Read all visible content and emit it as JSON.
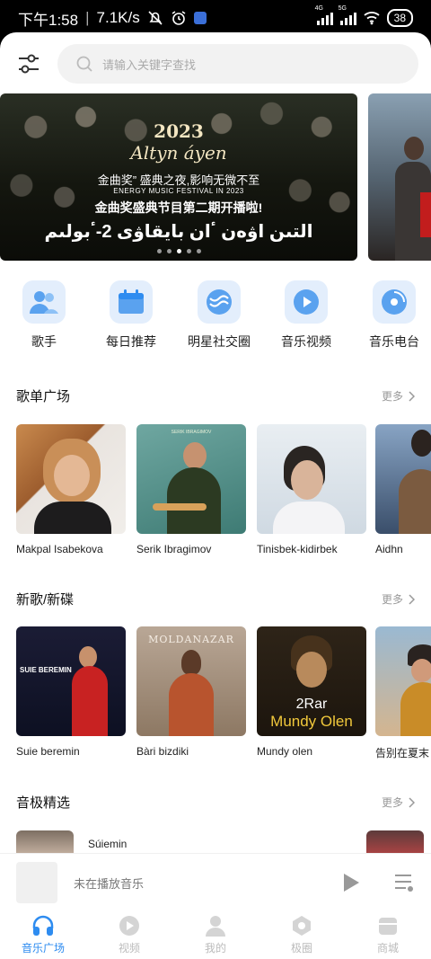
{
  "status_bar": {
    "time": "下午1:58",
    "speed": "7.1K/s",
    "network1": "4G",
    "network2": "5G",
    "battery": "38"
  },
  "search": {
    "placeholder": "请输入关键字查找"
  },
  "banner": {
    "year": "2023",
    "name": "Altyn áyen",
    "line1": "金曲奖” 盛典之夜,影响无微不至",
    "line2": "ENERGY MUSIC FESTIVAL IN 2023",
    "line3": "金曲奖盛典节目第二期开播啦!",
    "line4": "التىن اۋەن ٴان بايقاۋى 2-ٴبولىم"
  },
  "categories": [
    {
      "label": "歌手",
      "icon": "singer-icon"
    },
    {
      "label": "每日推荐",
      "icon": "calendar-icon"
    },
    {
      "label": "明星社交圈",
      "icon": "social-icon"
    },
    {
      "label": "音乐视频",
      "icon": "video-icon"
    },
    {
      "label": "音乐电台",
      "icon": "radio-icon"
    }
  ],
  "section_playlists": {
    "title": "歌单广场",
    "more": "更多",
    "items": [
      {
        "title": "Makpal Isabekova"
      },
      {
        "title": "Serik Ibragimov",
        "cover_text": "SERIK IBRAGIMOV"
      },
      {
        "title": "Tinisbek-kidirbek"
      },
      {
        "title": "Aidhn"
      }
    ]
  },
  "section_albums": {
    "title": "新歌/新碟",
    "more": "更多",
    "items": [
      {
        "title": "Suie beremin",
        "cover_text": "SUIE BEREMIN"
      },
      {
        "title": "Bàri bizdiki",
        "cover_text": "MOLDANAZAR"
      },
      {
        "title": "Mundy olen",
        "cover_text_1": "2Rar",
        "cover_text_2": "Mundy Olen"
      },
      {
        "title": "告别在夏末"
      }
    ]
  },
  "section_selected": {
    "title": "音极精选",
    "more": "更多",
    "first_item": "Súiemin"
  },
  "player": {
    "status": "未在播放音乐"
  },
  "tabs": [
    {
      "label": "音乐广场",
      "active": true,
      "icon": "headphones-icon"
    },
    {
      "label": "视频",
      "active": false,
      "icon": "video-play-icon"
    },
    {
      "label": "我的",
      "active": false,
      "icon": "user-icon"
    },
    {
      "label": "极圈",
      "active": false,
      "icon": "circle-icon"
    },
    {
      "label": "商城",
      "active": false,
      "icon": "shop-icon"
    }
  ],
  "colors": {
    "accent": "#2e8cf0",
    "icon_bg": "#e3eefc"
  }
}
